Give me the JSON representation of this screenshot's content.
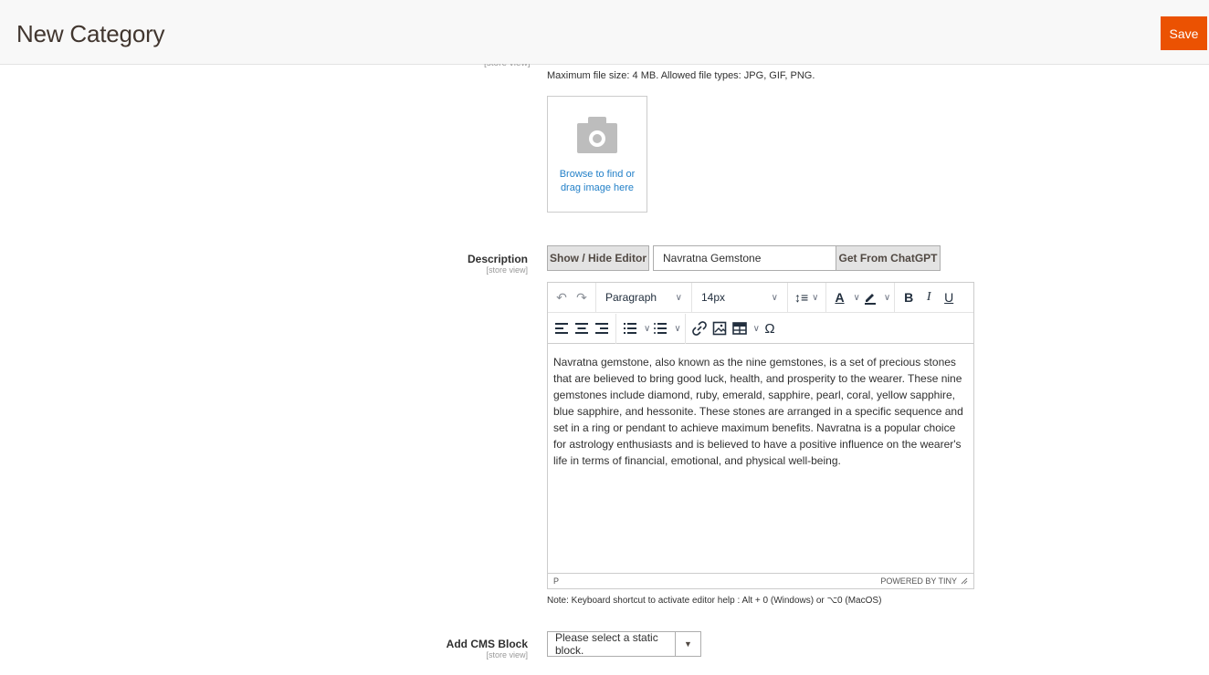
{
  "header": {
    "title": "New Category",
    "save_label": "Save"
  },
  "image_field": {
    "clipped_scope": "[store view]",
    "file_note": "Maximum file size: 4 MB. Allowed file types: JPG, GIF, PNG.",
    "browse_line1": "Browse to find or",
    "browse_line2": "drag image here",
    "icon": "camera-icon"
  },
  "description": {
    "label": "Description",
    "scope": "[store view]",
    "toggle_label": "Show / Hide Editor",
    "prompt_value": "Navratna Gemstone",
    "chatgpt_label": "Get From ChatGPT"
  },
  "editor": {
    "block_format": "Paragraph",
    "font_size": "14px",
    "content": "Navratna gemstone, also known as the nine gemstones, is a set of precious stones that are believed to bring good luck, health, and prosperity to the wearer. These nine gemstones include diamond, ruby, emerald, sapphire, pearl, coral, yellow sapphire, blue sapphire, and hessonite. These stones are arranged in a specific sequence and set in a ring or pendant to achieve maximum benefits. Navratna is a popular choice for astrology enthusiasts and is believed to have a positive influence on the wearer's life in terms of financial, emotional, and physical well-being.",
    "path": "P",
    "powered_by": "POWERED BY TINY",
    "toolbar_glyphs": {
      "undo": "↶",
      "redo": "↷",
      "line_height": "↕≡",
      "text_color": "A",
      "bold": "B",
      "italic": "I",
      "underline": "U",
      "special_char": "Ω"
    },
    "shortcut_note": "Note: Keyboard shortcut to activate editor help : Alt + 0 (Windows) or ⌥0 (MacOS)"
  },
  "cms_block": {
    "label": "Add CMS Block",
    "scope": "[store view]",
    "selected": "Please select a static block."
  },
  "colors": {
    "accent": "#eb5202",
    "link": "#2380c8"
  }
}
